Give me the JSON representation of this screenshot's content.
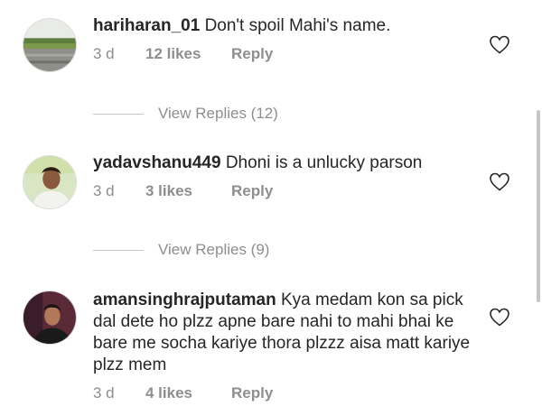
{
  "comments": [
    {
      "username": "hariharan_01",
      "text": "Don't spoil Mahi's name.",
      "time": "3 d",
      "likes": "12 likes",
      "reply_label": "Reply",
      "view_replies": "View Replies (12)"
    },
    {
      "username": "yadavshanu449",
      "text": "Dhoni is a unlucky parson",
      "time": "3 d",
      "likes": "3 likes",
      "reply_label": "Reply",
      "view_replies": "View Replies (9)"
    },
    {
      "username": "amansinghrajputaman",
      "text": "Kya medam kon sa pick dal dete ho plzz apne bare nahi to mahi bhai ke bare me socha kariye thora plzzz aisa matt kariye plzz mem",
      "time": "3 d",
      "likes": "4 likes",
      "reply_label": "Reply"
    }
  ],
  "icons": {
    "like": "heart-outline-icon",
    "avatar_1": "avatar-plants-photo",
    "avatar_2": "avatar-person-photo",
    "avatar_3": "avatar-person-photo"
  },
  "colors": {
    "text": "#262626",
    "secondary": "#8e8e8e",
    "divider": "#c7c7c7"
  }
}
